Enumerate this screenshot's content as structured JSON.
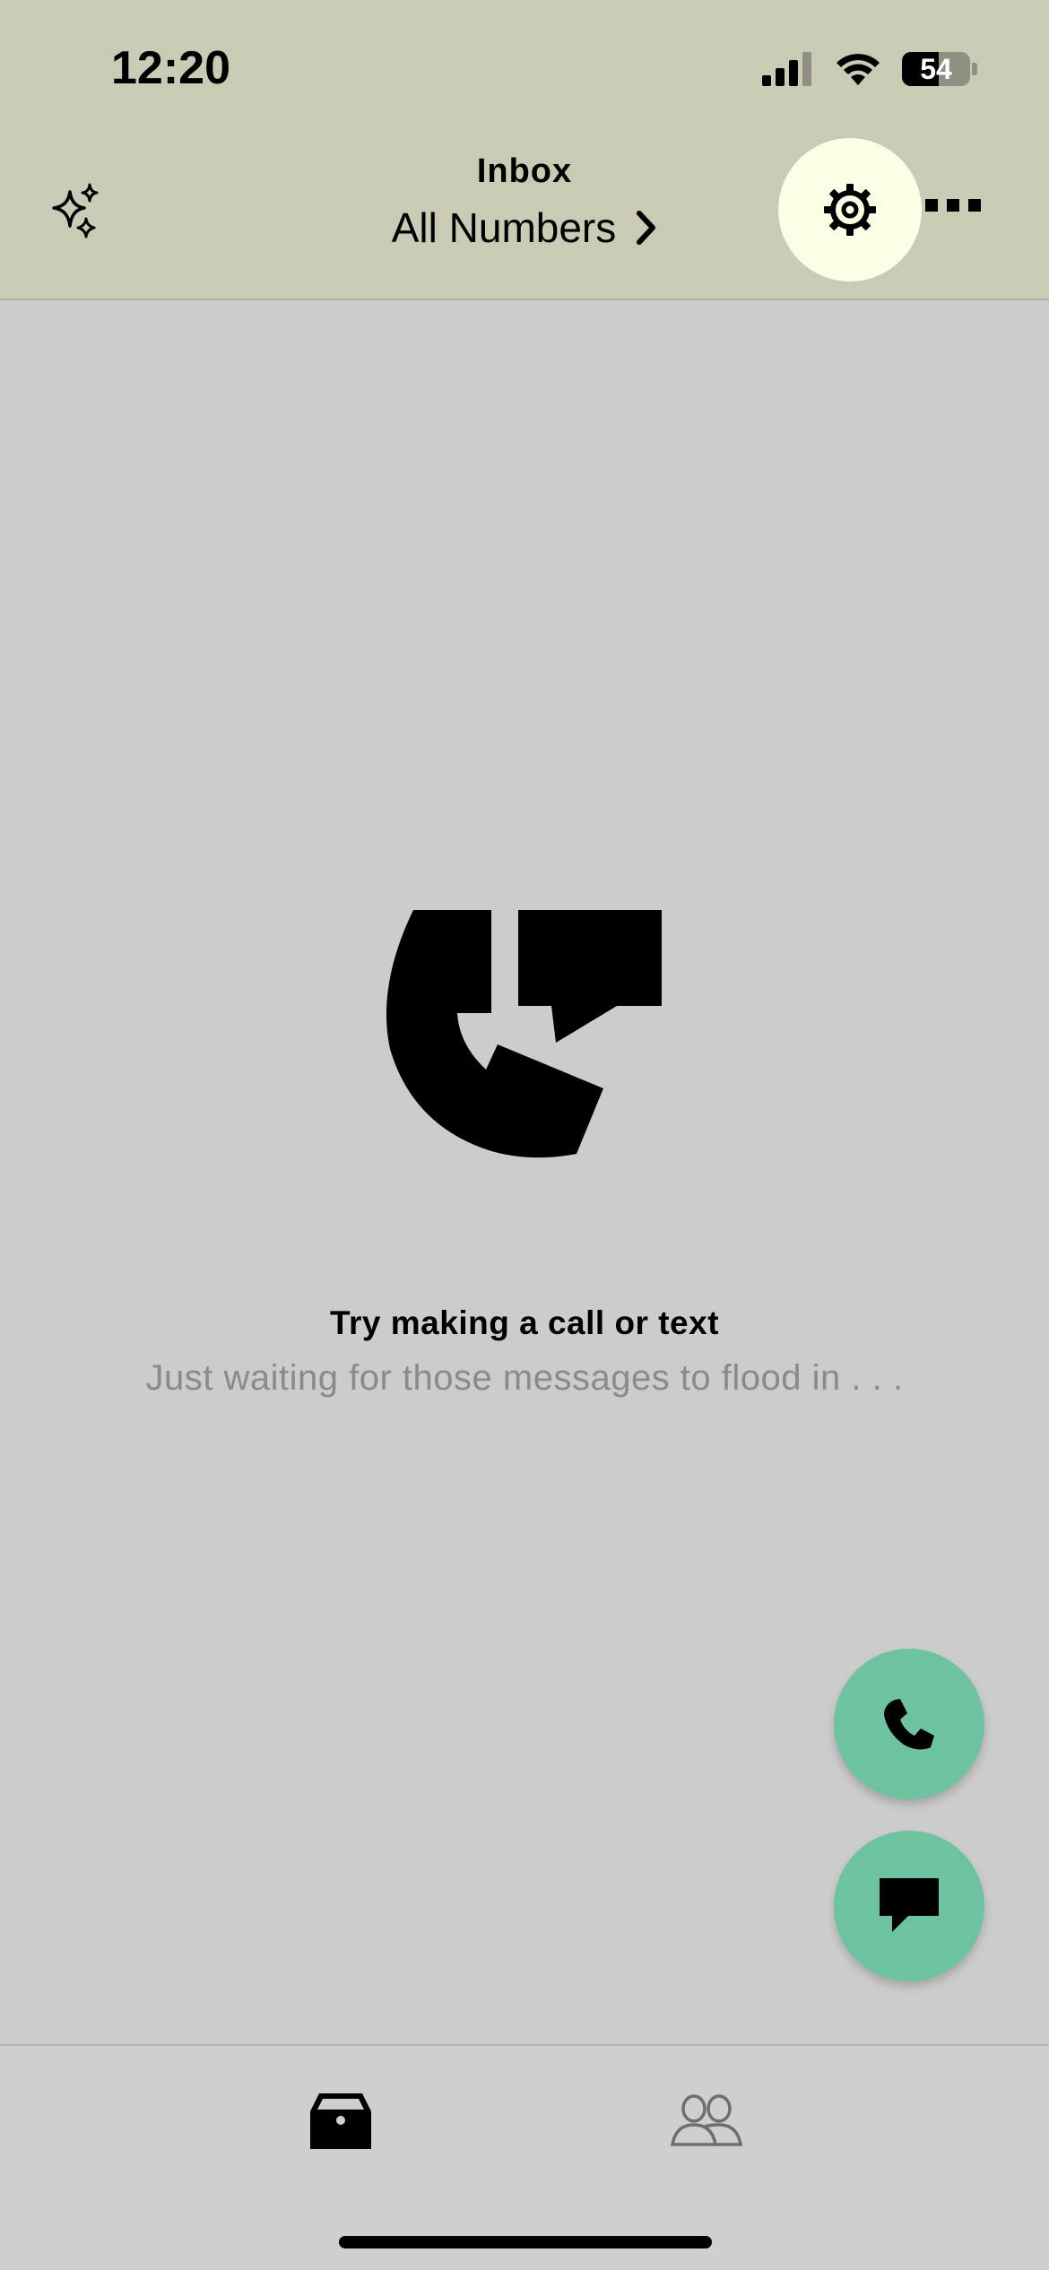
{
  "status_bar": {
    "time": "12:20",
    "battery_level": "54",
    "icons": [
      "cellular-signal-icon",
      "wifi-icon",
      "battery-icon"
    ]
  },
  "header": {
    "title": "Inbox",
    "subtitle": "All Numbers",
    "left_icon": "sparkle-icon",
    "right_icons": [
      "gear-icon",
      "more-icon"
    ]
  },
  "empty_state": {
    "icon": "phone-message-logo-icon",
    "title": "Try making a call or text",
    "subtitle": "Just waiting for those messages to flood in . . ."
  },
  "fabs": [
    {
      "icon": "phone-icon",
      "color": "#6dc2a0"
    },
    {
      "icon": "message-icon",
      "color": "#6dc2a0"
    }
  ],
  "tabbar": {
    "tabs": [
      {
        "icon": "inbox-icon",
        "active": true
      },
      {
        "icon": "contacts-icon",
        "active": false
      }
    ]
  },
  "colors": {
    "header_bg": "#cbcbb5",
    "body_bg": "#cccccc",
    "accent": "#6dc2a0",
    "gear_highlight": "#fdfde6"
  }
}
